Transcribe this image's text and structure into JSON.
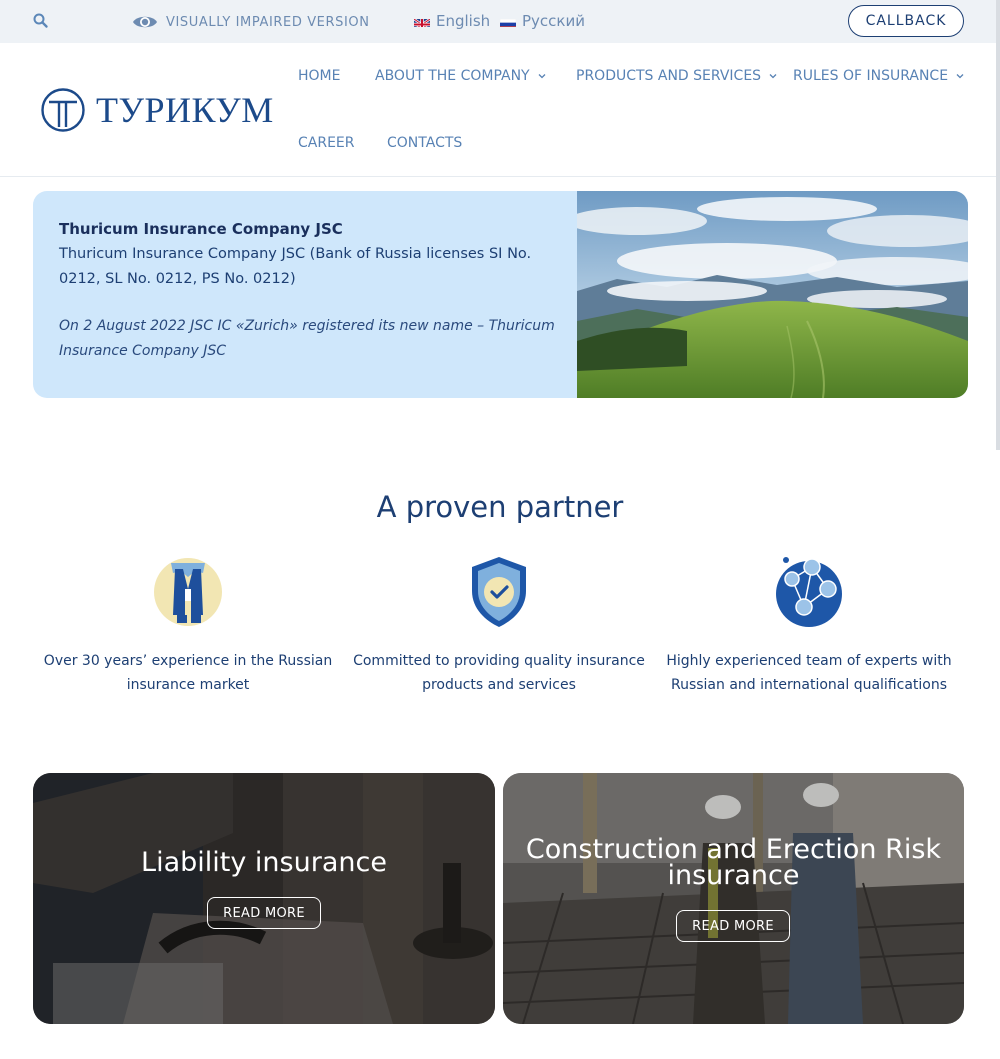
{
  "topbar": {
    "search_icon": "search-icon",
    "visually_impaired": "VISUALLY IMPAIRED VERSION",
    "languages": [
      {
        "label": "English",
        "flag": "uk-flag-icon"
      },
      {
        "label": "Русский",
        "flag": "ru-flag-icon"
      }
    ],
    "callback": "CALLBACK"
  },
  "header": {
    "logo_text": "ТУРИКУМ",
    "nav": [
      {
        "label": "HOME",
        "dropdown": false
      },
      {
        "label": "ABOUT THE COMPANY",
        "dropdown": true
      },
      {
        "label": "PRODUCTS AND SERVICES",
        "dropdown": true
      },
      {
        "label": "RULES OF INSURANCE",
        "dropdown": true
      },
      {
        "label": "CAREER",
        "dropdown": false
      },
      {
        "label": "CONTACTS",
        "dropdown": false
      }
    ]
  },
  "hero": {
    "title": "Thuricum Insurance Company JSC",
    "description": "Thuricum Insurance Company JSC (Bank of Russia licenses SI No. 0212, SL No. 0212, PS No. 0212)",
    "note": "On 2 August 2022 JSC IC «Zurich» registered its new name – Thuricum Insurance Company JSC"
  },
  "partner": {
    "title": "A proven partner",
    "features": [
      {
        "icon": "experience-icon",
        "text": "Over 30 years’ experience in the Russian insurance market"
      },
      {
        "icon": "shield-check-icon",
        "text": "Committed to providing quality insurance products and services"
      },
      {
        "icon": "team-network-icon",
        "text": "Highly experienced team of experts with Russian and international qualifications"
      }
    ]
  },
  "cards": [
    {
      "title": "Liability insurance",
      "button": "READ MORE"
    },
    {
      "title": "Construction and Erection Risk insurance",
      "button": "READ MORE"
    }
  ],
  "colors": {
    "primary": "#1d3f73",
    "nav": "#5882b4",
    "topbar_bg": "#eef2f6",
    "hero_bg": "#cfe7fb"
  }
}
